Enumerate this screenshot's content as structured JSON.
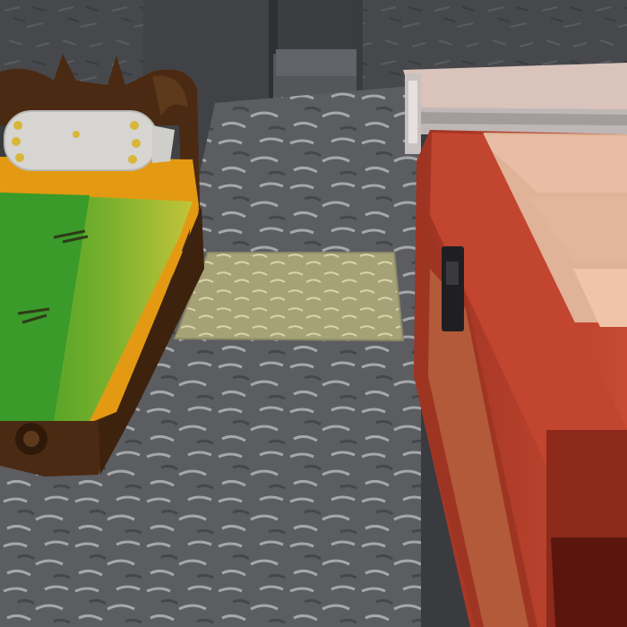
{
  "scene": {
    "description_free": true,
    "palette": {
      "wall_stone": "#4a4b4f",
      "floor_stone": "#5f6064",
      "floor_crack": "#c9c9cc",
      "rug": "#a9a57a",
      "bed_frame": "#4a2a12",
      "blanket_green": "#5da32a",
      "blanket_yellow": "#b4c23a",
      "blanket_orange": "#e39a12",
      "pillow": "#d8d7d3",
      "chest_red": "#c8432f",
      "chest_dark": "#7a2718",
      "chest_lid": "#e2b39a",
      "table_top": "#ddc7bf",
      "latch": "#1f1f22"
    },
    "objects": {
      "bed": "bed",
      "pillow": "pillow",
      "rug": "rug",
      "chest": "chest",
      "table": "table",
      "doorway": "doorway"
    }
  }
}
